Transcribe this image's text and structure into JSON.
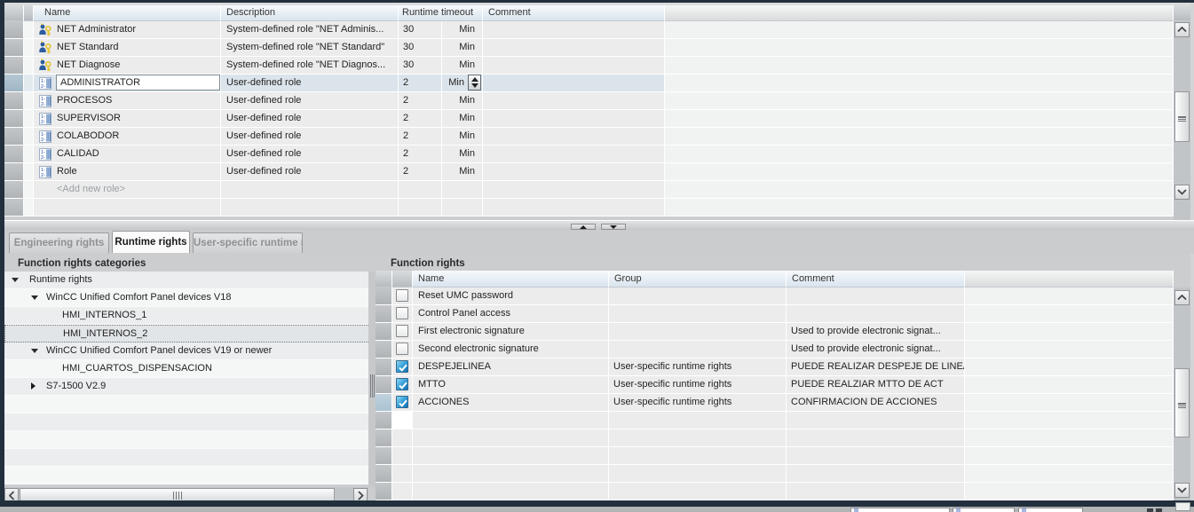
{
  "top_table": {
    "columns": {
      "name": "Name",
      "description": "Description",
      "runtime_timeout": "Runtime timeout",
      "comment": "Comment"
    },
    "unit_label": "Min",
    "rows": [
      {
        "icon": "system-role-icon",
        "name": "NET Administrator",
        "description": "System-defined role \"NET Adminis...",
        "timeout": "30",
        "unit": "Min",
        "selected": false
      },
      {
        "icon": "system-role-icon",
        "name": "NET Standard",
        "description": "System-defined role \"NET Standard\"",
        "timeout": "30",
        "unit": "Min",
        "selected": false
      },
      {
        "icon": "system-role-icon",
        "name": "NET Diagnose",
        "description": "System-defined role \"NET Diagnos...",
        "timeout": "30",
        "unit": "Min",
        "selected": false
      },
      {
        "icon": "user-role-icon",
        "name": "ADMINISTRATOR",
        "description": "User-defined role",
        "timeout": "2",
        "unit": "Min",
        "selected": true
      },
      {
        "icon": "user-role-icon",
        "name": "PROCESOS",
        "description": "User-defined role",
        "timeout": "2",
        "unit": "Min",
        "selected": false
      },
      {
        "icon": "user-role-icon",
        "name": "SUPERVISOR",
        "description": "User-defined role",
        "timeout": "2",
        "unit": "Min",
        "selected": false
      },
      {
        "icon": "user-role-icon",
        "name": "COLABODOR",
        "description": "User-defined role",
        "timeout": "2",
        "unit": "Min",
        "selected": false
      },
      {
        "icon": "user-role-icon",
        "name": "CALIDAD",
        "description": "User-defined role",
        "timeout": "2",
        "unit": "Min",
        "selected": false
      },
      {
        "icon": "user-role-icon",
        "name": "Role",
        "description": "User-defined role",
        "timeout": "2",
        "unit": "Min",
        "selected": false
      }
    ],
    "add_row_label": "<Add new role>"
  },
  "tabs": [
    {
      "label": "Engineering rights",
      "active": false
    },
    {
      "label": "Runtime rights",
      "active": true
    },
    {
      "label": "User-specific runtime rights",
      "active": false
    }
  ],
  "left_panel": {
    "title": "Function rights categories",
    "tree": [
      {
        "label": "Runtime rights",
        "level": 0,
        "state": "expanded",
        "selected": false
      },
      {
        "label": "WinCC Unified Comfort Panel devices V18",
        "level": 1,
        "state": "expanded",
        "selected": false
      },
      {
        "label": "HMI_INTERNOS_1",
        "level": 2,
        "state": "leaf",
        "selected": false
      },
      {
        "label": "HMI_INTERNOS_2",
        "level": 2,
        "state": "leaf",
        "selected": true
      },
      {
        "label": "WinCC Unified Comfort Panel devices V19 or newer",
        "level": 1,
        "state": "expanded",
        "selected": false
      },
      {
        "label": "HMI_CUARTOS_DISPENSACION",
        "level": 2,
        "state": "leaf",
        "selected": false
      },
      {
        "label": "S7-1500 V2.9",
        "level": 1,
        "state": "collapsed",
        "selected": false
      }
    ]
  },
  "right_panel": {
    "title": "Function rights",
    "columns": {
      "name": "Name",
      "group": "Group",
      "comment": "Comment"
    },
    "rows": [
      {
        "checked": false,
        "name": "Reset UMC password",
        "group": "",
        "comment": ""
      },
      {
        "checked": false,
        "name": "Control Panel access",
        "group": "",
        "comment": ""
      },
      {
        "checked": false,
        "name": "First electronic signature",
        "group": "",
        "comment": "Used to provide electronic signat..."
      },
      {
        "checked": false,
        "name": "Second electronic signature",
        "group": "",
        "comment": "Used to provide electronic signat..."
      },
      {
        "checked": true,
        "name": "DESPEJELINEA",
        "group": "User-specific runtime rights",
        "comment": "PUEDE REALIZAR DESPEJE DE LINEA"
      },
      {
        "checked": true,
        "name": "MTTO",
        "group": "User-specific runtime rights",
        "comment": "PUEDE REALZIAR MTTO DE ACT"
      },
      {
        "checked": true,
        "name": "ACCIONES",
        "group": "User-specific runtime rights",
        "comment": "CONFIRMACION DE ACCIONES"
      }
    ]
  },
  "colors": {
    "frame_dark": "#222f3d",
    "header_gradient_top": "#f7fafc",
    "header_gradient_bottom": "#d9e4ee",
    "row_gray": "#ececec",
    "selection_blue": "#dbe4ea",
    "checkbox_blue": "#1473b8",
    "panel_gray": "#cbcdcf"
  }
}
